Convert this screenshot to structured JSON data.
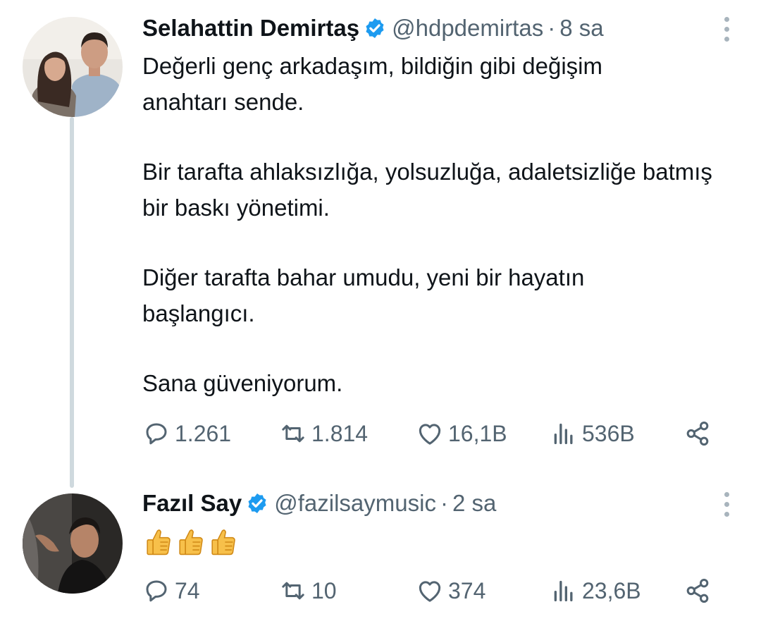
{
  "thread": [
    {
      "author": {
        "name": "Selahattin Demirtaş",
        "handle": "@hdpdemirtas",
        "time": "8 sa",
        "verified": true,
        "avatar": "couple-photo-avatar"
      },
      "paragraphs": [
        "Değerli genç arkadaşım, bildiğin gibi değişim anahtarı sende.",
        "Bir tarafta ahlaksızlığa, yolsuzluğa, adaletsizliğe batmış bir baskı yönetimi.",
        "Diğer tarafta bahar umudu, yeni bir hayatın başlangıcı.",
        "Sana güveniyorum."
      ],
      "stats": {
        "replies": "1.261",
        "retweets": "1.814",
        "likes": "16,1B",
        "views": "536B"
      }
    },
    {
      "author": {
        "name": "Fazıl Say",
        "handle": "@fazilsaymusic",
        "time": "2 sa",
        "verified": true,
        "avatar": "man-portrait-avatar"
      },
      "emojis": [
        "thumbs-up",
        "thumbs-up",
        "thumbs-up"
      ],
      "stats": {
        "replies": "74",
        "retweets": "10",
        "likes": "374",
        "views": "23,6B"
      }
    }
  ],
  "icons": {
    "reply": "reply-icon",
    "retweet": "retweet-icon",
    "like": "heart-icon",
    "views": "views-chart-icon",
    "share": "share-icon",
    "more": "more-vertical-icon",
    "verified": "verified-badge-icon"
  },
  "colors": {
    "text": "#0f1419",
    "secondary": "#536471",
    "verified": "#1d9bf0",
    "thread_line": "#cfd9de"
  },
  "separator": "·"
}
